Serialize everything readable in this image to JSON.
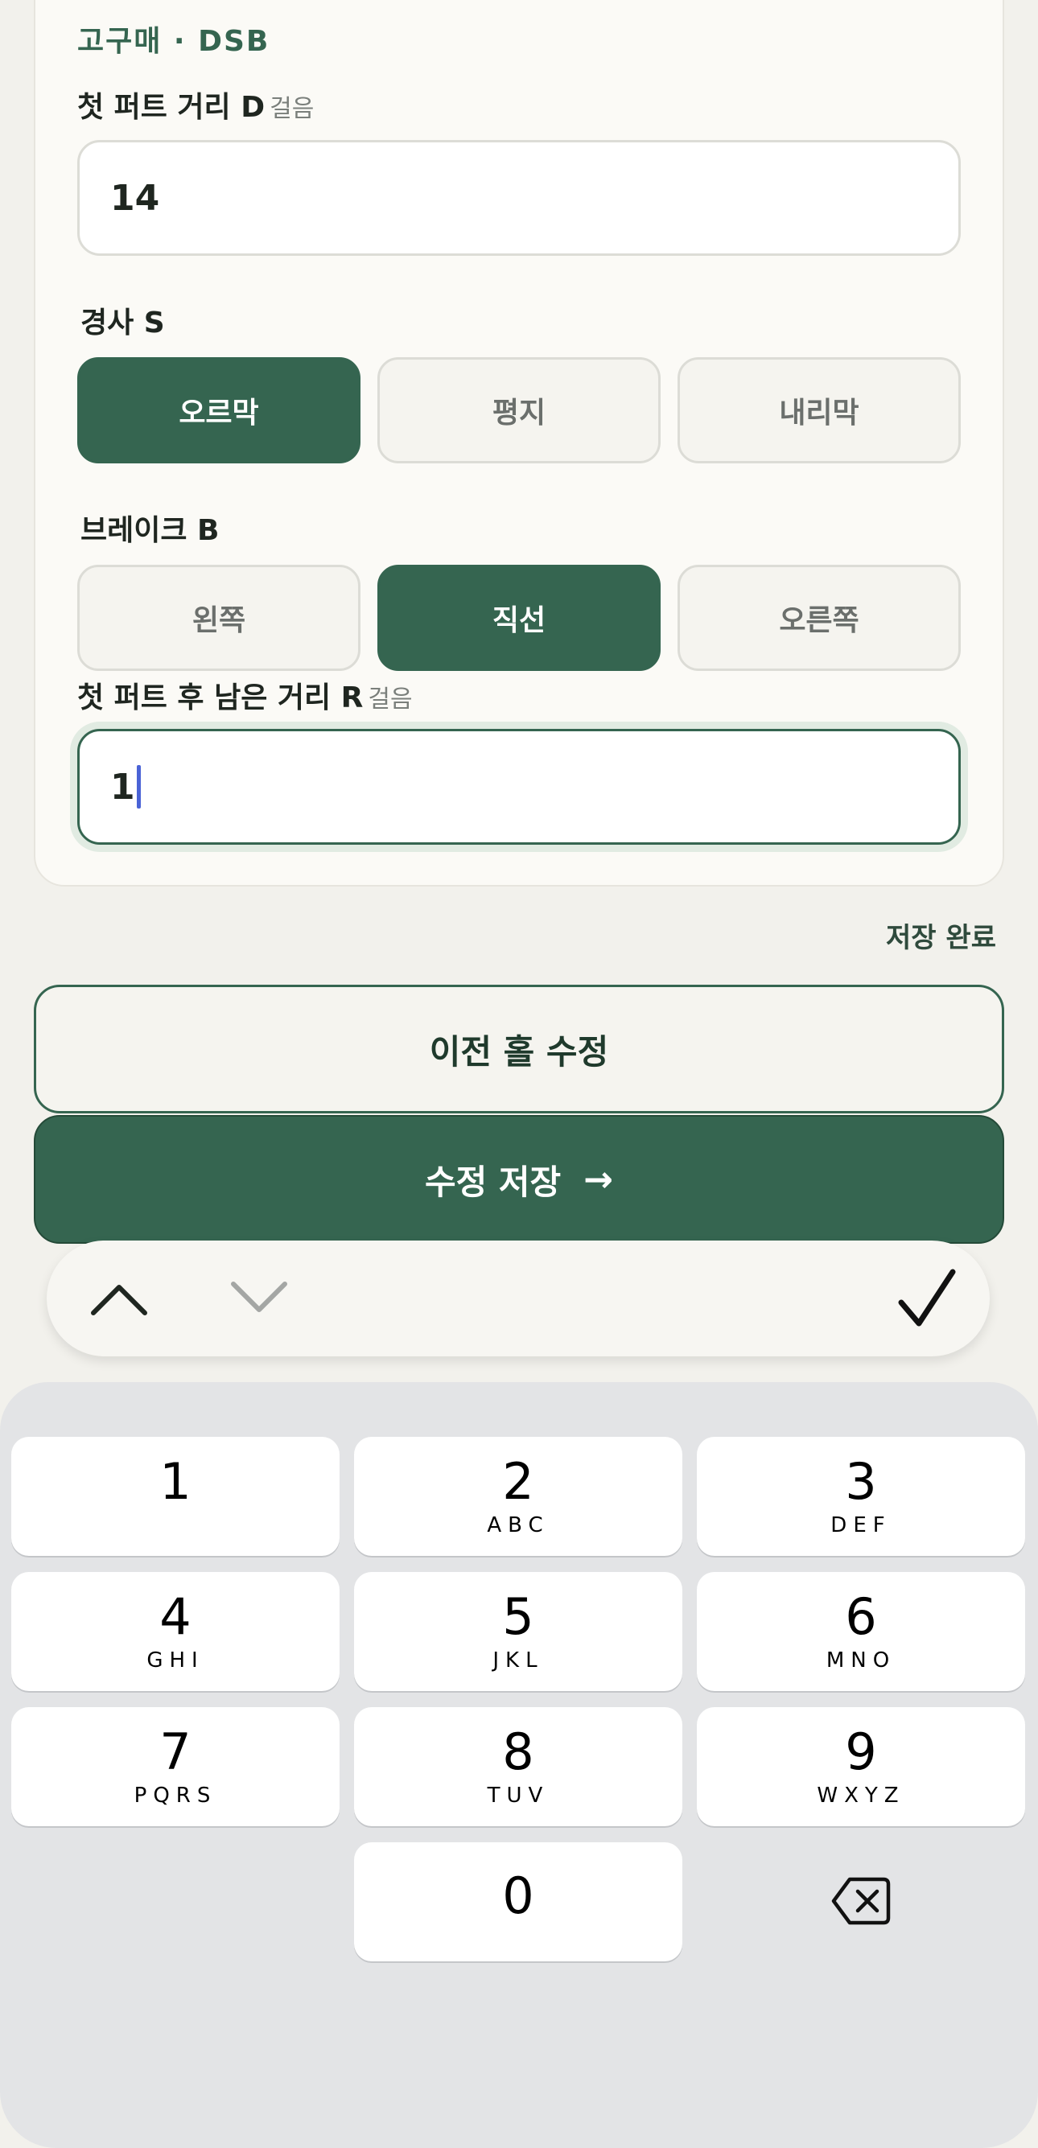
{
  "form": {
    "section_title": "고구매 · DSB",
    "distance": {
      "label": "첫 퍼트 거리 D",
      "unit": "걸음",
      "value": "14"
    },
    "slope": {
      "label": "경사 S",
      "options": [
        "오르막",
        "평지",
        "내리막"
      ],
      "selected": "오르막"
    },
    "break": {
      "label": "브레이크 B",
      "options": [
        "왼쪽",
        "직선",
        "오른쪽"
      ],
      "selected": "직선"
    },
    "remaining": {
      "label": "첫 퍼트 후 남은 거리 R",
      "unit": "걸음",
      "value": "1"
    }
  },
  "status": {
    "save_text": "저장 완료"
  },
  "actions": {
    "prev_hole_label": "이전 홀 수정",
    "save_label": "수정 저장",
    "save_arrow": "→"
  },
  "accessory_bar": {
    "icons": [
      "chevron-up-icon",
      "chevron-down-icon",
      "checkmark-icon"
    ],
    "down_enabled": false
  },
  "keypad": {
    "keys": [
      {
        "digit": "1",
        "letters": ""
      },
      {
        "digit": "2",
        "letters": "ABC"
      },
      {
        "digit": "3",
        "letters": "DEF"
      },
      {
        "digit": "4",
        "letters": "GHI"
      },
      {
        "digit": "5",
        "letters": "JKL"
      },
      {
        "digit": "6",
        "letters": "MNO"
      },
      {
        "digit": "7",
        "letters": "PQRS"
      },
      {
        "digit": "8",
        "letters": "TUV"
      },
      {
        "digit": "9",
        "letters": "WXYZ"
      },
      {
        "digit": "0",
        "letters": ""
      }
    ],
    "delete_icon": "backspace-icon"
  },
  "colors": {
    "accent": "#356550",
    "background": "#f2f1ec",
    "keyboard_bg": "#e3e4e6",
    "caret": "#4a63d6"
  }
}
